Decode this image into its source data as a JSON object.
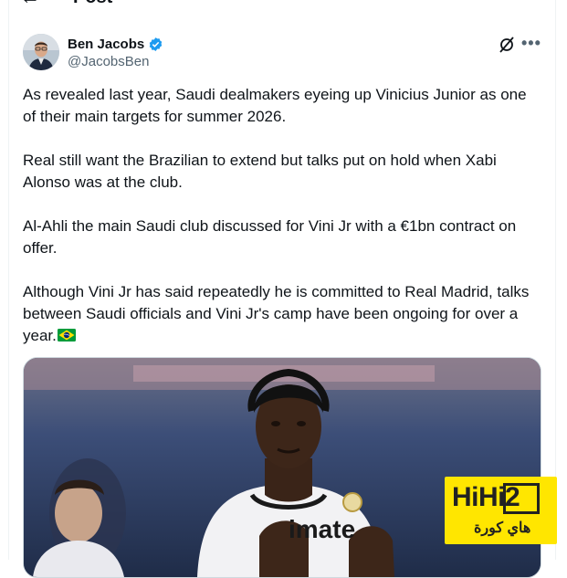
{
  "header": {
    "back_icon": "arrow-left-icon",
    "title": "Post"
  },
  "author": {
    "display_name": "Ben Jacobs",
    "handle": "@JacobsBen",
    "verified_color": "#1d9bf0"
  },
  "tweet": {
    "paragraphs": [
      "As revealed last year, Saudi dealmakers eyeing up Vinicius Junior as one of their main targets for summer 2026.",
      "Real still want the Brazilian to extend but talks put on hold when Xabi Alonso was at the club.",
      "Al-Ahli the main Saudi club discussed for Vini Jr with a €1bn contract on offer.",
      "Although Vini Jr has said repeatedly he is committed to Real Madrid, talks between Saudi officials and Vini Jr's camp have been ongoing for over a year."
    ],
    "flag_icon": "brazil-flag-icon"
  },
  "media": {
    "jersey_text": "imate"
  },
  "watermark": {
    "brand": "HiHi2",
    "arabic": "هاي كورة",
    "color": "#ffe600"
  },
  "colors": {
    "text": "#0f1419",
    "secondary": "#536471",
    "accent": "#1d9bf0"
  }
}
